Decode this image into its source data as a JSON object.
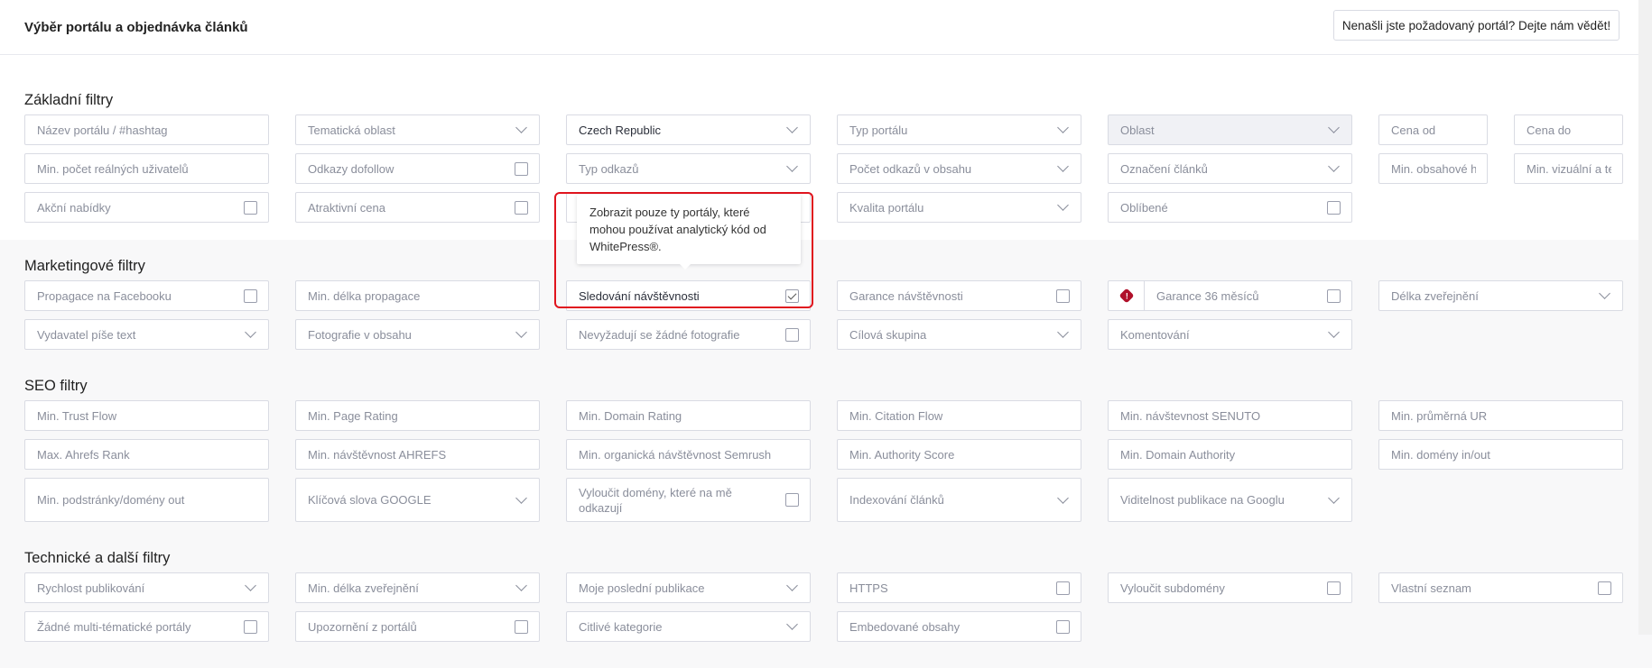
{
  "header": {
    "title": "Výběr portálu a objednávka článků",
    "feedback_button": "Nenašli jste požadovaný portál? Dejte nám vědět!"
  },
  "sections": [
    {
      "title": "Základní filtry",
      "rows": [
        [
          {
            "label": "Název portálu / #hashtag",
            "type": "text"
          },
          {
            "label": "Tematická oblast",
            "type": "select"
          },
          {
            "label": "Czech Republic",
            "type": "select",
            "selected": true
          },
          {
            "label": "Typ portálu",
            "type": "select"
          },
          {
            "label": "Oblast",
            "type": "select",
            "disabled": true
          },
          {
            "label": "Cena od",
            "type": "text"
          },
          {
            "label": "Cena do",
            "type": "text"
          }
        ],
        [
          {
            "label": "Min. počet reálných uživatelů",
            "type": "text"
          },
          {
            "label": "Odkazy dofollow",
            "type": "checkbox",
            "checked": false
          },
          {
            "label": "Typ odkazů",
            "type": "select"
          },
          {
            "label": "Počet odkazů v obsahu",
            "type": "select"
          },
          {
            "label": "Označení článků",
            "type": "select"
          },
          {
            "label": "Min. obsahové hoc",
            "type": "text"
          },
          {
            "label": "Min. vizuální a tecl",
            "type": "text"
          }
        ],
        [
          {
            "label": "Akční nabídky",
            "type": "checkbox",
            "checked": false
          },
          {
            "label": "Atraktivní cena",
            "type": "checkbox",
            "checked": false
          },
          {
            "label": "",
            "type": "text"
          },
          {
            "label": "Kvalita portálu",
            "type": "select"
          },
          {
            "label": "Oblíbené",
            "type": "checkbox",
            "checked": false
          }
        ]
      ]
    },
    {
      "title": "Marketingové filtry",
      "rows": [
        [
          {
            "label": "Propagace na Facebooku",
            "type": "checkbox",
            "checked": false
          },
          {
            "label": "Min. délka propagace",
            "type": "text"
          },
          {
            "label": "Sledování návštěvnosti",
            "type": "checkbox",
            "checked": true
          },
          {
            "label": "Garance návštěvnosti",
            "type": "checkbox",
            "checked": false
          },
          {
            "label": "Garance 36 měsíců",
            "type": "checkbox",
            "checked": false,
            "icon": "alert-badge-icon"
          },
          {
            "label": "Délka zveřejnění",
            "type": "select"
          }
        ],
        [
          {
            "label": "Vydavatel píše text",
            "type": "select"
          },
          {
            "label": "Fotografie v obsahu",
            "type": "select"
          },
          {
            "label": "Nevyžadují se žádné fotografie",
            "type": "checkbox",
            "checked": false
          },
          {
            "label": "Cílová skupina",
            "type": "select"
          },
          {
            "label": "Komentování",
            "type": "select"
          }
        ]
      ]
    },
    {
      "title": "SEO filtry",
      "rows": [
        [
          {
            "label": "Min. Trust Flow",
            "type": "text"
          },
          {
            "label": "Min. Page Rating",
            "type": "text"
          },
          {
            "label": "Min. Domain Rating",
            "type": "text"
          },
          {
            "label": "Min. Citation Flow",
            "type": "text"
          },
          {
            "label": "Min. návštevnost SENUTO",
            "type": "text"
          },
          {
            "label": "Min. průměrná UR",
            "type": "text"
          }
        ],
        [
          {
            "label": "Max. Ahrefs Rank",
            "type": "text"
          },
          {
            "label": "Min. návštěvnost AHREFS",
            "type": "text"
          },
          {
            "label": "Min. organická návštěvnost Semrush",
            "type": "text"
          },
          {
            "label": "Min. Authority Score",
            "type": "text"
          },
          {
            "label": "Min. Domain Authority",
            "type": "text"
          },
          {
            "label": "Min. domény in/out",
            "type": "text"
          }
        ],
        [
          {
            "label": "Min. podstránky/domény out",
            "type": "text"
          },
          {
            "label": "Klíčová slova GOOGLE",
            "type": "select"
          },
          {
            "label": "Vyloučit domény, které na mě odkazují",
            "type": "checkbox",
            "checked": false
          },
          {
            "label": "Indexování článků",
            "type": "select"
          },
          {
            "label": "Viditelnost publikace na Googlu",
            "type": "select"
          }
        ]
      ]
    },
    {
      "title": "Technické a další filtry",
      "rows": [
        [
          {
            "label": "Rychlost publikování",
            "type": "select"
          },
          {
            "label": "Min. délka zveřejnění",
            "type": "select"
          },
          {
            "label": "Moje poslední publikace",
            "type": "select"
          },
          {
            "label": "HTTPS",
            "type": "checkbox",
            "checked": false
          },
          {
            "label": "Vyloučit subdomény",
            "type": "checkbox",
            "checked": false
          },
          {
            "label": "Vlastní seznam",
            "type": "checkbox",
            "checked": false
          }
        ],
        [
          {
            "label": "Žádné multi-tématické portály",
            "type": "checkbox",
            "checked": false
          },
          {
            "label": "Upozornění z portálů",
            "type": "checkbox",
            "checked": false
          },
          {
            "label": "Citlivé kategorie",
            "type": "select"
          },
          {
            "label": "Embedované obsahy",
            "type": "checkbox",
            "checked": false
          }
        ]
      ]
    }
  ],
  "tooltip": {
    "text": "Zobrazit pouze ty portály, které mohou používat analytický kód od WhitePress®."
  },
  "colors": {
    "highlight": "#e0141e",
    "alert_badge": "#b0102a",
    "gray_bg": "#f8f8f9"
  }
}
